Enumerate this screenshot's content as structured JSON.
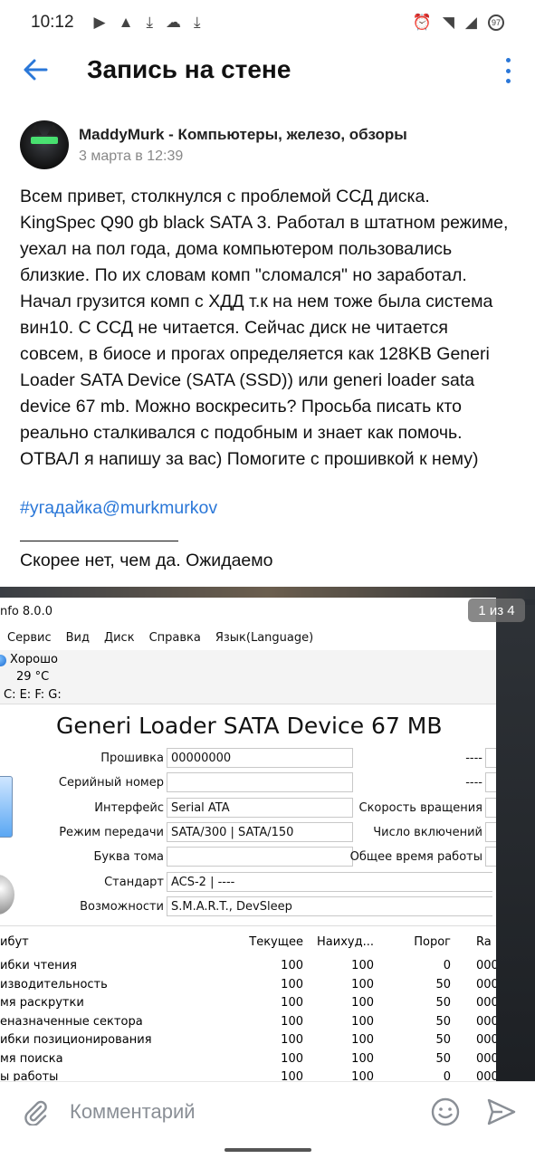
{
  "status_bar": {
    "time": "10:12",
    "battery": "97"
  },
  "header": {
    "title": "Запись на стене"
  },
  "post": {
    "author": "MaddyMurk - Компьютеры, железо, обзоры",
    "date": "3 марта в 12:39",
    "lines": [
      "Всем привет, столкнулся с проблемой ССД диска.",
      "KingSpec Q90 gb black SATA 3. Работал в штатном режиме,",
      "уехал на пол года, дома компьютером пользовались",
      "близкие. По их словам комп \"сломался\" но заработал.",
      "Начал грузится комп с ХДД т.к на нем тоже была система",
      "вин10. С ССД не читается. Сейчас диск не читается",
      "совсем, в биосе и прогах определяется как 128KB Generi",
      "Loader SATA Device (SATA (SSD)) или generi loader sata",
      "device 67 mb. Можно воскресить? Просьба писать кто",
      "реально сталкивался с подобным и знает как помочь.",
      "ОТВАЛ я напишу за вас) Помогите с прошивкой к нему)"
    ],
    "hashtag": "#угадайка@murkmurkov",
    "comment_note": "Скорее нет, чем да. Ожидаемо"
  },
  "attachment": {
    "counter": "1 из 4",
    "app": {
      "title_fragment": "nfo 8.0.0",
      "menu": [
        "Сервис",
        "Вид",
        "Диск",
        "Справка",
        "Язык(Language)"
      ],
      "health": "Хорошо",
      "temperature": "29 °C",
      "drives": "C: E: F: G:",
      "device_title": "Generi Loader SATA Device 67 MB",
      "fields": [
        {
          "label": "Прошивка",
          "value": "00000000"
        },
        {
          "label": "Серийный номер",
          "value": ""
        },
        {
          "label": "Интерфейс",
          "value": "Serial ATA"
        },
        {
          "label": "Режим передачи",
          "value": "SATA/300 | SATA/150"
        },
        {
          "label": "Буква тома",
          "value": ""
        },
        {
          "label": "Стандарт",
          "value": "ACS-2 | ----"
        },
        {
          "label": "Возможности",
          "value": "S.M.A.R.T., DevSleep"
        }
      ],
      "right_fields": [
        {
          "label": "----"
        },
        {
          "label": "----"
        },
        {
          "label": "Скорость вращения"
        },
        {
          "label": "Число включений"
        },
        {
          "label": "Общее время работы"
        }
      ],
      "smart_headers": [
        "ибут",
        "Текущее",
        "Наихуд...",
        "Порог",
        "Ra"
      ],
      "smart_rows": [
        {
          "attr": "ибки чтения",
          "cur": "100",
          "worst": "100",
          "thr": "0",
          "raw": "000"
        },
        {
          "attr": "изводительность",
          "cur": "100",
          "worst": "100",
          "thr": "50",
          "raw": "000"
        },
        {
          "attr": "мя раскрутки",
          "cur": "100",
          "worst": "100",
          "thr": "50",
          "raw": "000"
        },
        {
          "attr": "еназначенные сектора",
          "cur": "100",
          "worst": "100",
          "thr": "50",
          "raw": "000"
        },
        {
          "attr": "ибки позиционирования",
          "cur": "100",
          "worst": "100",
          "thr": "50",
          "raw": "000"
        },
        {
          "attr": "мя поиска",
          "cur": "100",
          "worst": "100",
          "thr": "50",
          "raw": "000"
        },
        {
          "attr": "ы работы",
          "cur": "100",
          "worst": "100",
          "thr": "0",
          "raw": "000"
        }
      ]
    }
  },
  "composer": {
    "placeholder": "Комментарий"
  },
  "colors": {
    "accent": "#2a77d8",
    "secondary_text": "#888888"
  }
}
